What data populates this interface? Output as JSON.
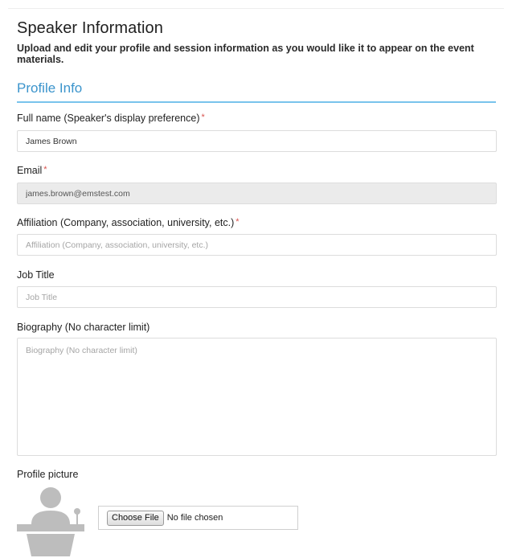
{
  "header": {
    "title": "Speaker Information",
    "subtitle": "Upload and edit your profile and session information as you would like it to appear on the event materials."
  },
  "section": {
    "heading": "Profile Info"
  },
  "fields": {
    "full_name": {
      "label": "Full name (Speaker's display preference)",
      "required_mark": "*",
      "value": "James Brown"
    },
    "email": {
      "label": "Email",
      "required_mark": "*",
      "value": "james.brown@emstest.com"
    },
    "affiliation": {
      "label": "Affiliation (Company, association, university, etc.)",
      "required_mark": "*",
      "placeholder": "Affiliation (Company, association, university, etc.)"
    },
    "job_title": {
      "label": "Job Title",
      "placeholder": "Job Title"
    },
    "biography": {
      "label": "Biography (No character limit)",
      "placeholder": "Biography (No character limit)"
    },
    "profile_picture": {
      "label": "Profile picture",
      "button_label": "Choose File",
      "status": "No file chosen"
    }
  },
  "colors": {
    "accent": "#3b94cc",
    "accent_rule": "#79c3ec",
    "required": "#d9534f",
    "avatar": "#bdbdbd"
  },
  "icons": {
    "avatar": "speaker-at-podium-icon"
  }
}
